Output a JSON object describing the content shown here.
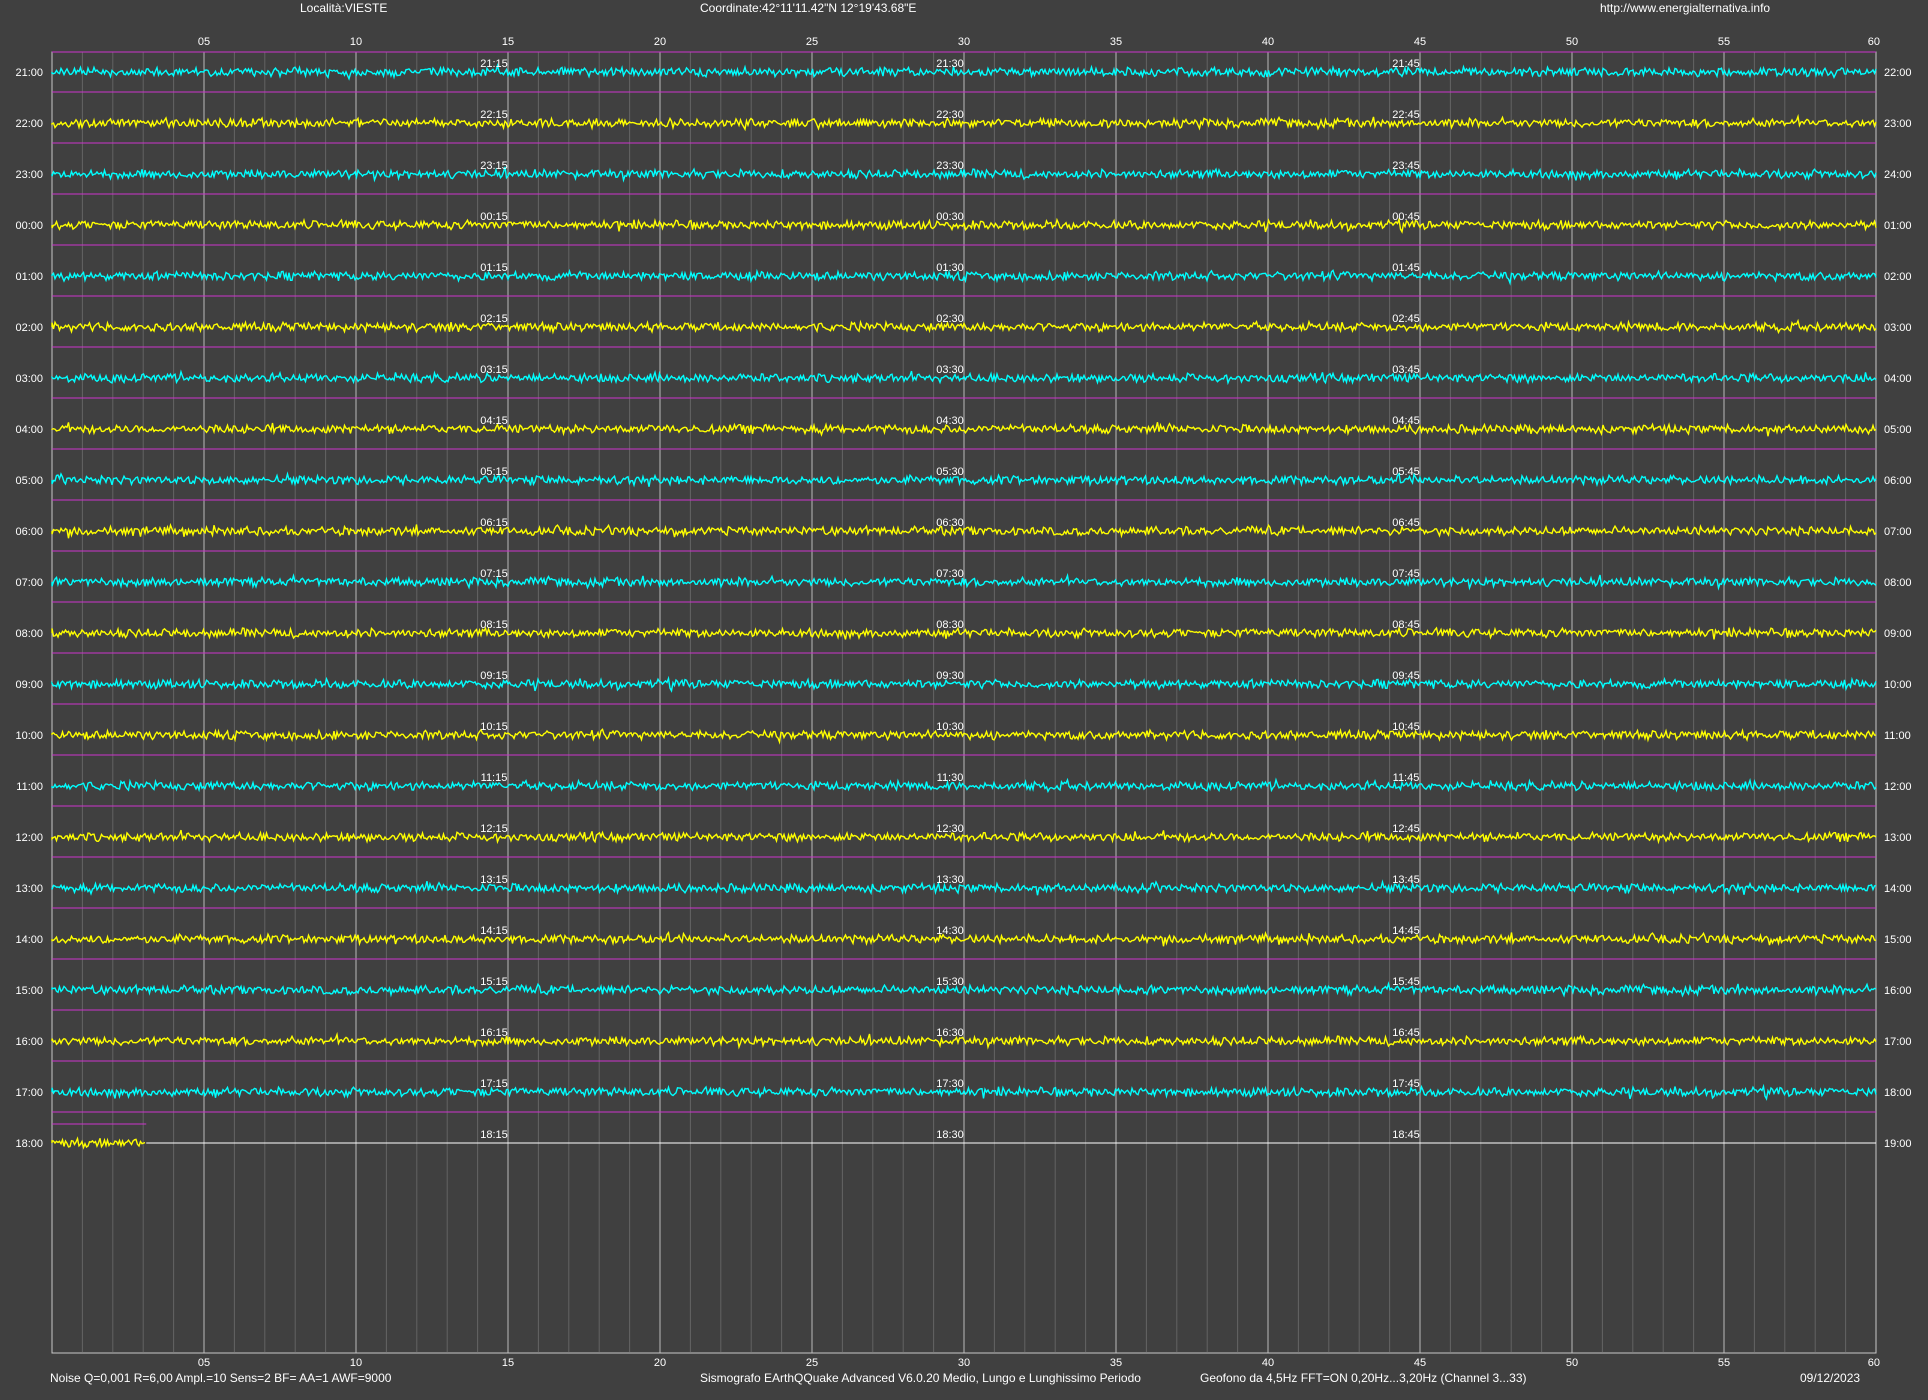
{
  "header": {
    "location": "Località:VIESTE",
    "coordinates": "Coordinate:42°11'11.42\"N  12°19'43.68\"E",
    "website": "http://www.energialternativa.info"
  },
  "footer": {
    "params": "Noise Q=0,001 R=6,00 Ampl.=10 Sens=2 BF= AA=1 AWF=9000",
    "software": "Sismografo  EArthQQuake Advanced V6.0.20  Medio, Lungo e Lunghissimo Periodo",
    "sensor": "Geofono da 4,5Hz FFT=ON 0,20Hz...3,20Hz      (Channel 3...33)",
    "date": "09/12/2023"
  },
  "colors": {
    "background": "#404040",
    "trace_odd": "#00ffff",
    "trace_even": "#ffff00",
    "minute_grid": "#808080",
    "major_grid": "#c8c8c8",
    "baseline": "#cc33cc",
    "text": "#ffffff"
  },
  "chart_data": {
    "type": "line",
    "x_axis_label_ticks": [
      "05",
      "10",
      "15",
      "20",
      "25",
      "30",
      "35",
      "40",
      "45",
      "50",
      "55",
      "60"
    ],
    "x_range_minutes": [
      0,
      60
    ],
    "grid": "minor every 1 minute, major every 5 minutes",
    "rows": [
      {
        "left": "21:00",
        "right": "22:00",
        "marks": [
          "21:15",
          "21:30",
          "21:45"
        ],
        "color": "cyan",
        "fill_minutes": 60
      },
      {
        "left": "22:00",
        "right": "23:00",
        "marks": [
          "22:15",
          "22:30",
          "22:45"
        ],
        "color": "yellow",
        "fill_minutes": 60
      },
      {
        "left": "23:00",
        "right": "24:00",
        "marks": [
          "23:15",
          "23:30",
          "23:45"
        ],
        "color": "cyan",
        "fill_minutes": 60
      },
      {
        "left": "00:00",
        "right": "01:00",
        "marks": [
          "00:15",
          "00:30",
          "00:45"
        ],
        "color": "yellow",
        "fill_minutes": 60
      },
      {
        "left": "01:00",
        "right": "02:00",
        "marks": [
          "01:15",
          "01:30",
          "01:45"
        ],
        "color": "cyan",
        "fill_minutes": 60
      },
      {
        "left": "02:00",
        "right": "03:00",
        "marks": [
          "02:15",
          "02:30",
          "02:45"
        ],
        "color": "yellow",
        "fill_minutes": 60
      },
      {
        "left": "03:00",
        "right": "04:00",
        "marks": [
          "03:15",
          "03:30",
          "03:45"
        ],
        "color": "cyan",
        "fill_minutes": 60
      },
      {
        "left": "04:00",
        "right": "05:00",
        "marks": [
          "04:15",
          "04:30",
          "04:45"
        ],
        "color": "yellow",
        "fill_minutes": 60
      },
      {
        "left": "05:00",
        "right": "06:00",
        "marks": [
          "05:15",
          "05:30",
          "05:45"
        ],
        "color": "cyan",
        "fill_minutes": 60
      },
      {
        "left": "06:00",
        "right": "07:00",
        "marks": [
          "06:15",
          "06:30",
          "06:45"
        ],
        "color": "yellow",
        "fill_minutes": 60
      },
      {
        "left": "07:00",
        "right": "08:00",
        "marks": [
          "07:15",
          "07:30",
          "07:45"
        ],
        "color": "cyan",
        "fill_minutes": 60
      },
      {
        "left": "08:00",
        "right": "09:00",
        "marks": [
          "08:15",
          "08:30",
          "08:45"
        ],
        "color": "yellow",
        "fill_minutes": 60
      },
      {
        "left": "09:00",
        "right": "10:00",
        "marks": [
          "09:15",
          "09:30",
          "09:45"
        ],
        "color": "cyan",
        "fill_minutes": 60
      },
      {
        "left": "10:00",
        "right": "11:00",
        "marks": [
          "10:15",
          "10:30",
          "10:45"
        ],
        "color": "yellow",
        "fill_minutes": 60
      },
      {
        "left": "11:00",
        "right": "12:00",
        "marks": [
          "11:15",
          "11:30",
          "11:45"
        ],
        "color": "cyan",
        "fill_minutes": 60
      },
      {
        "left": "12:00",
        "right": "13:00",
        "marks": [
          "12:15",
          "12:30",
          "12:45"
        ],
        "color": "yellow",
        "fill_minutes": 60
      },
      {
        "left": "13:00",
        "right": "14:00",
        "marks": [
          "13:15",
          "13:30",
          "13:45"
        ],
        "color": "cyan",
        "fill_minutes": 60
      },
      {
        "left": "14:00",
        "right": "15:00",
        "marks": [
          "14:15",
          "14:30",
          "14:45"
        ],
        "color": "yellow",
        "fill_minutes": 60
      },
      {
        "left": "15:00",
        "right": "16:00",
        "marks": [
          "15:15",
          "15:30",
          "15:45"
        ],
        "color": "cyan",
        "fill_minutes": 60
      },
      {
        "left": "16:00",
        "right": "17:00",
        "marks": [
          "16:15",
          "16:30",
          "16:45"
        ],
        "color": "yellow",
        "fill_minutes": 60
      },
      {
        "left": "17:00",
        "right": "18:00",
        "marks": [
          "17:15",
          "17:30",
          "17:45"
        ],
        "color": "cyan",
        "fill_minutes": 60
      },
      {
        "left": "18:00",
        "right": "19:00",
        "marks": [
          "18:15",
          "18:30",
          "18:45"
        ],
        "color": "yellow",
        "fill_minutes": 3.1
      }
    ]
  }
}
